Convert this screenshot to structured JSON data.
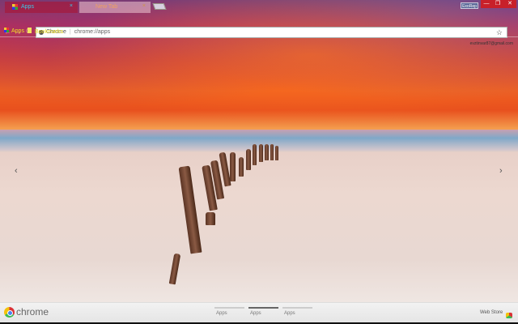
{
  "tabs": [
    {
      "label": "Apps",
      "close": "×",
      "active": true
    },
    {
      "label": "New Tab",
      "close": "×",
      "active": false
    }
  ],
  "window": {
    "user": "ExoRep",
    "minimize": "—",
    "restore": "❐",
    "close": "✕"
  },
  "toolbar": {
    "back": "←",
    "forward": "→",
    "reload": "C",
    "chip": "Chrome",
    "separator": "|",
    "url": "chrome://apps",
    "star": "☆"
  },
  "bookmarks": [
    {
      "label": "Apps",
      "icon": "apps-grid-icon"
    },
    {
      "label": "Bookmarks",
      "icon": "folder-icon"
    }
  ],
  "account": {
    "email": "evztinvar87@gmail.com"
  },
  "nav": {
    "prev": "‹",
    "next": "›"
  },
  "footer": {
    "brand": "chrome",
    "pages": [
      {
        "label": "Apps",
        "active": false
      },
      {
        "label": "Apps",
        "active": true
      },
      {
        "label": "Apps",
        "active": false
      }
    ],
    "webstore": "Web Store"
  },
  "colors": {
    "tab_text": "#3ec8e8",
    "bookmark_text": "#f0e020",
    "window_controls": "#c8202a"
  }
}
